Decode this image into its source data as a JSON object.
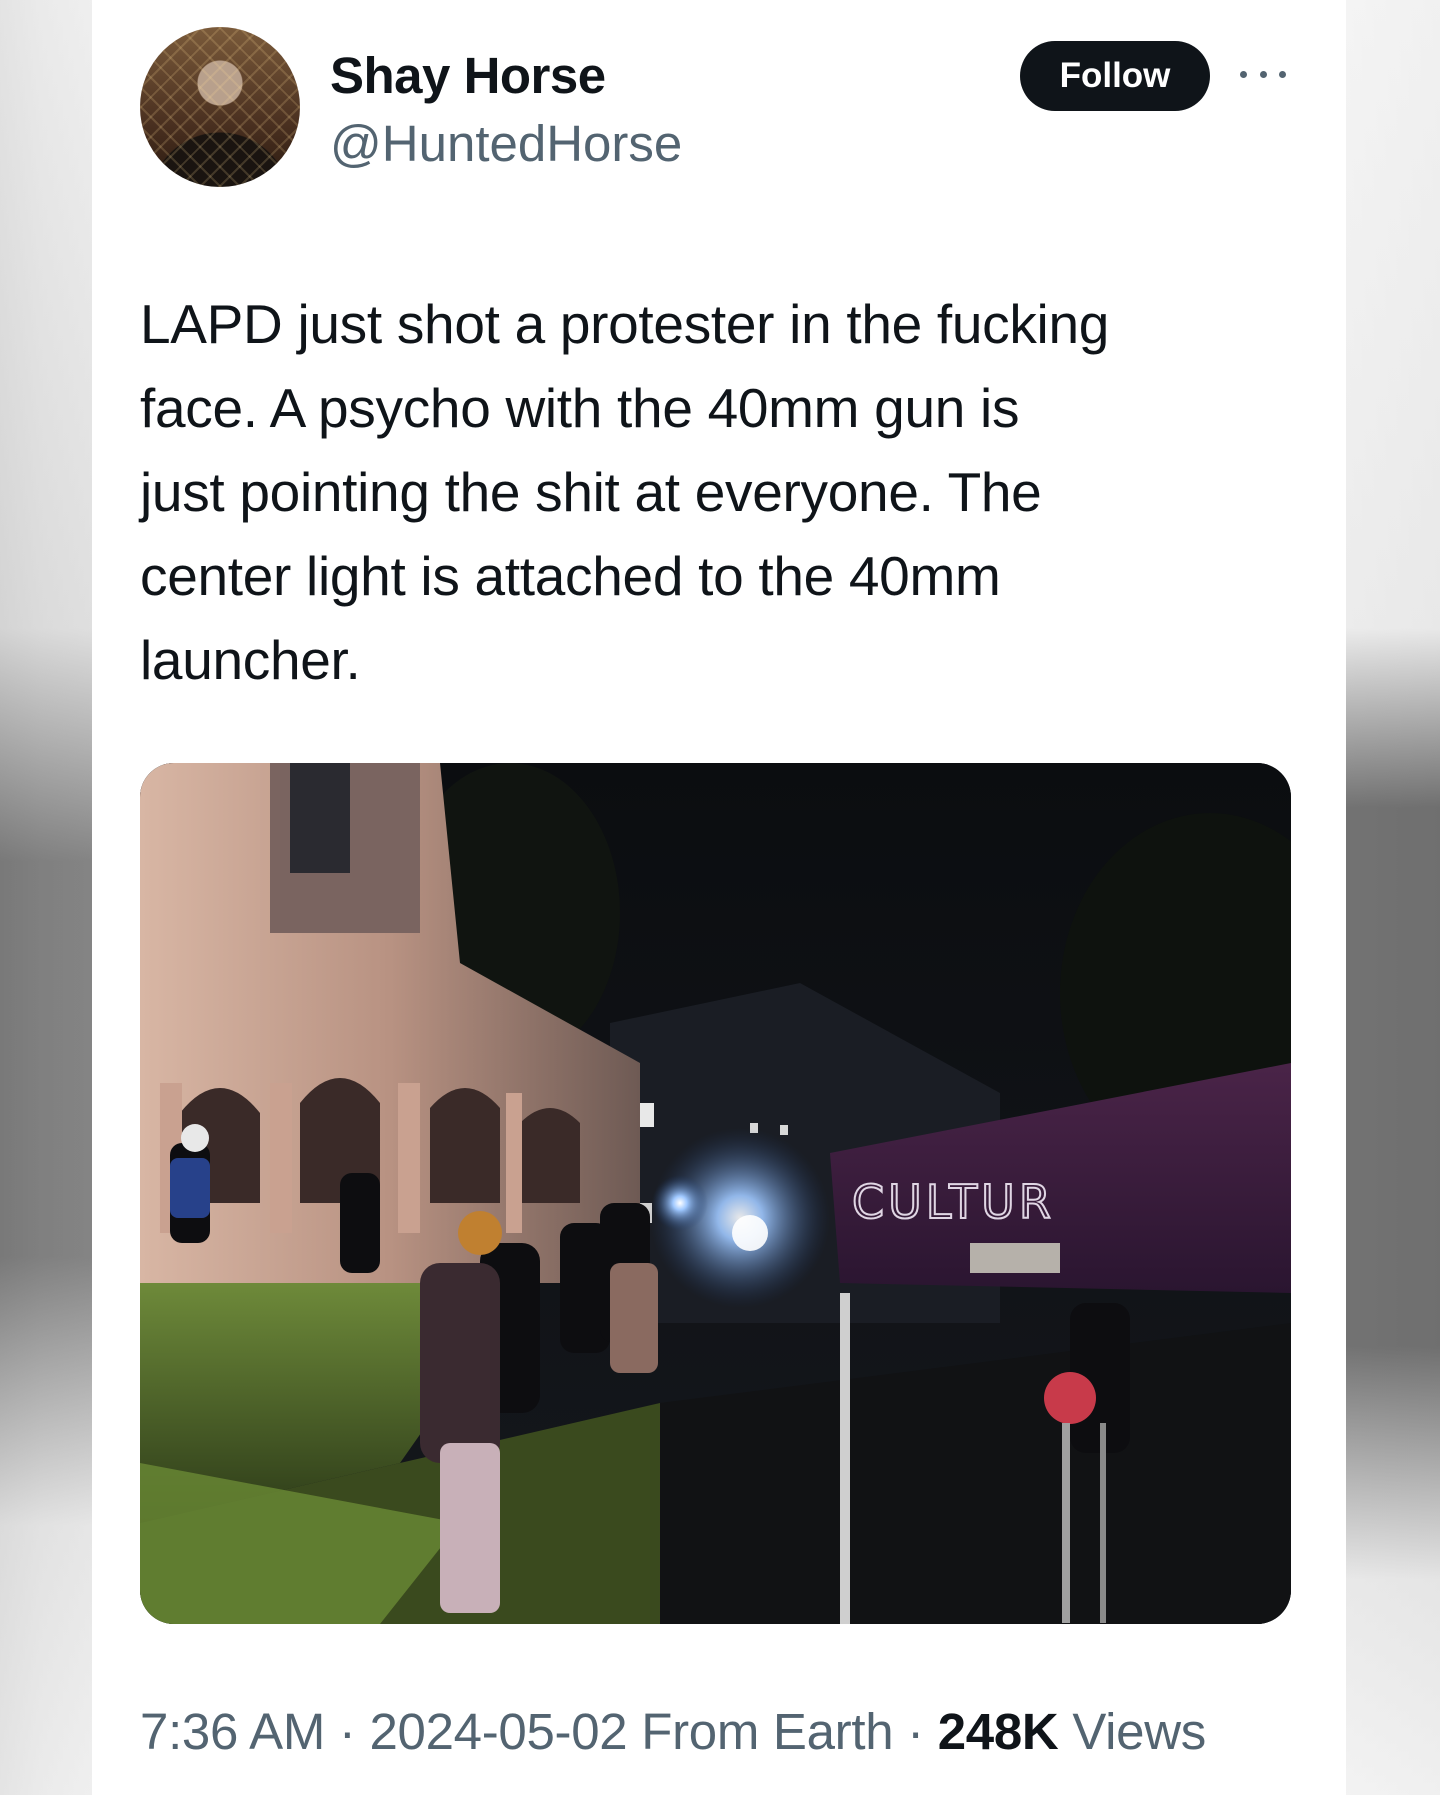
{
  "author": {
    "display_name": "Shay Horse",
    "handle": "@HuntedHorse"
  },
  "header": {
    "follow_label": "Follow",
    "more_icon": "more-horizontal-icon"
  },
  "tweet": {
    "text_lines": [
      "LAPD just shot a protester in the fucking",
      "face. A psycho with the 40mm gun is",
      "just pointing the shit at everyone. The",
      "center light is attached to the 40mm",
      "launcher."
    ],
    "media": {
      "sign_text": "CULTUR"
    }
  },
  "meta": {
    "time": "7:36 AM",
    "separator": "·",
    "date": "2024-05-02",
    "source": "From Earth",
    "views_count": "248K",
    "views_label": "Views"
  },
  "colors": {
    "text_primary": "#0f1419",
    "text_secondary": "#536471",
    "follow_bg": "#0f1419",
    "follow_text": "#ffffff"
  }
}
